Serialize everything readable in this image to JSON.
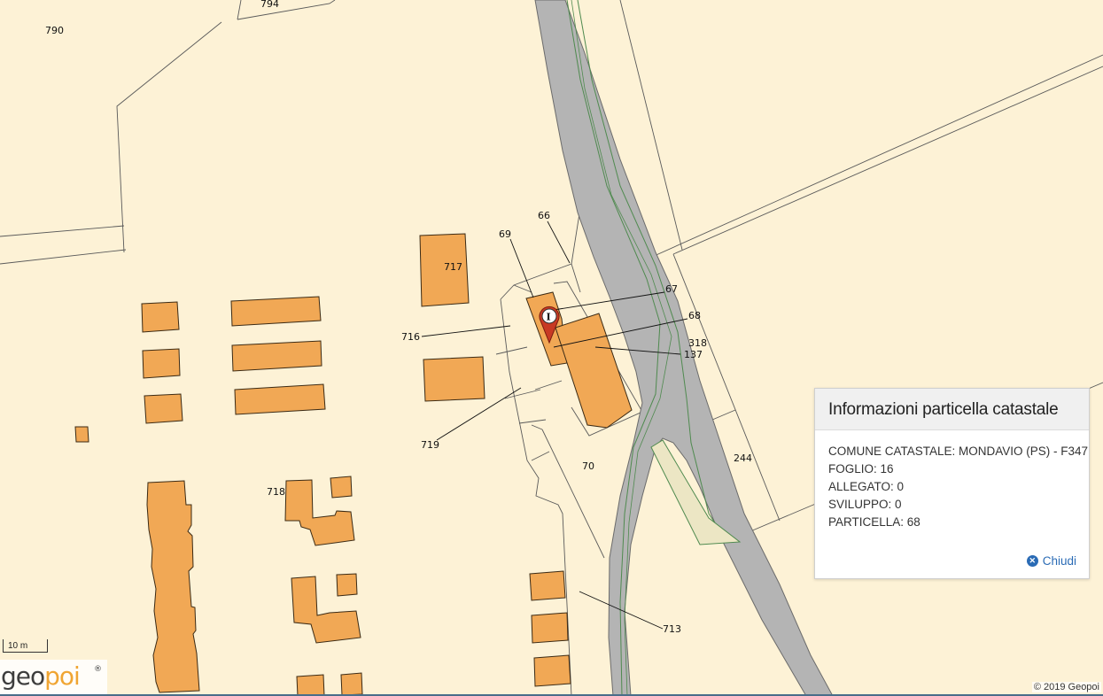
{
  "map": {
    "parcel_numbers": [
      {
        "text": "794"
      },
      {
        "text": "790"
      },
      {
        "text": "717"
      },
      {
        "text": "69"
      },
      {
        "text": "66"
      },
      {
        "text": "67"
      },
      {
        "text": "68"
      },
      {
        "text": "716"
      },
      {
        "text": "318"
      },
      {
        "text": "137"
      },
      {
        "text": "719"
      },
      {
        "text": "70"
      },
      {
        "text": "244"
      },
      {
        "text": "718"
      },
      {
        "text": "713"
      }
    ],
    "marker_icon": "info-marker-icon"
  },
  "info_panel": {
    "title": "Informazioni particella catastale",
    "rows": [
      "COMUNE CATASTALE: MONDAVIO (PS) - F347",
      "FOGLIO: 16",
      "ALLEGATO: 0",
      "SVILUPPO: 0",
      "PARTICELLA: 68"
    ],
    "close_label": "Chiudi",
    "close_icon": "close-circle-icon"
  },
  "scale_bar": {
    "label": "10 m"
  },
  "logo": {
    "geo": "geo",
    "poi": "poi",
    "reg": "®"
  },
  "attribution": "© 2019 Geopoi",
  "colors": {
    "land": "#fdf2d6",
    "road": "#b4b4b4",
    "building": "#f1a855",
    "link": "#2a6bb5"
  }
}
